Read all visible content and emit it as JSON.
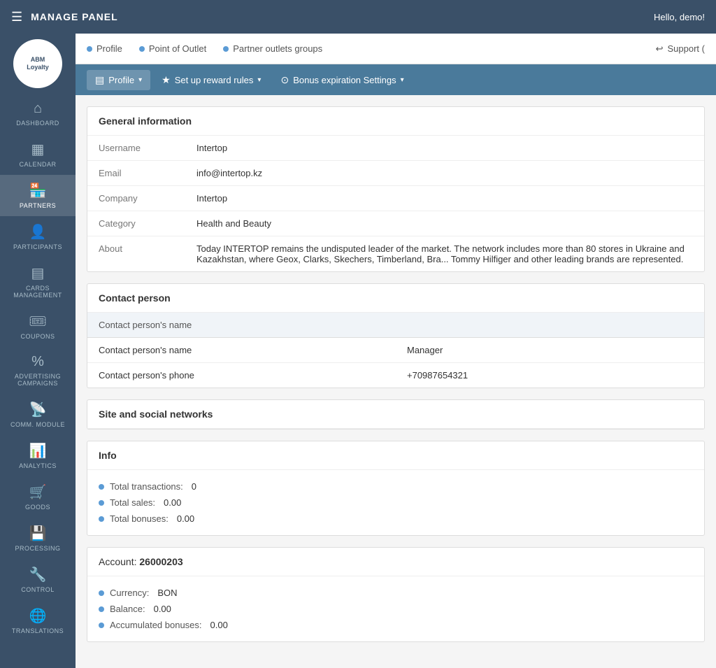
{
  "topbar": {
    "title": "MANAGE PANEL",
    "greeting": "Hello, demo!"
  },
  "logo": {
    "line1": "ABM",
    "line2": "Loyalty"
  },
  "sidebar": {
    "items": [
      {
        "label": "DASHBOARD",
        "icon": "⌂"
      },
      {
        "label": "CALENDAR",
        "icon": "▦"
      },
      {
        "label": "PARTNERS",
        "icon": "🏪",
        "active": true
      },
      {
        "label": "PARTICIPANTS",
        "icon": "👤"
      },
      {
        "label": "CARDS MANAGEMENT",
        "icon": "▤"
      },
      {
        "label": "COUPONS",
        "icon": "▤"
      },
      {
        "label": "ADVERTISING CAMPAIGNS",
        "icon": "%"
      },
      {
        "label": "COMM. MODULE",
        "icon": "📡"
      },
      {
        "label": "ANALYTICS",
        "icon": "📊"
      },
      {
        "label": "GOODS",
        "icon": "🛒"
      },
      {
        "label": "PROCESSING",
        "icon": "💾"
      },
      {
        "label": "CONTROL",
        "icon": "🔧"
      },
      {
        "label": "TRANSLATIONS",
        "icon": "🌐"
      }
    ]
  },
  "subnav": {
    "items": [
      {
        "label": "Profile"
      },
      {
        "label": "Point of Outlet"
      },
      {
        "label": "Partner outlets groups"
      }
    ],
    "support": "Support ("
  },
  "tabbar": {
    "tabs": [
      {
        "label": "Profile",
        "icon": "▤",
        "active": true
      },
      {
        "label": "Set up reward rules",
        "icon": "★"
      },
      {
        "label": "Bonus expiration Settings",
        "icon": "⊙"
      }
    ]
  },
  "general": {
    "section_title": "General information",
    "rows": [
      {
        "label": "Username",
        "value": "Intertop"
      },
      {
        "label": "Email",
        "value": "info@intertop.kz"
      },
      {
        "label": "Company",
        "value": "Intertop"
      },
      {
        "label": "Category",
        "value": "Health and Beauty"
      },
      {
        "label": "About",
        "value": "Today INTERTOP remains the undisputed leader of the market. The network includes more than 80 stores in Ukraine and Kazakhstan, where Geox, Clarks, Skechers, Timberland, Bra... Tommy Hilfiger and other leading brands are represented."
      }
    ]
  },
  "contact": {
    "section_title": "Contact person",
    "headers": [
      "Contact person's name",
      ""
    ],
    "rows": [
      {
        "label": "Contact person's name",
        "value": "Manager"
      },
      {
        "label": "Contact person's phone",
        "value": "+70987654321"
      }
    ]
  },
  "social": {
    "section_title": "Site and social networks"
  },
  "info": {
    "section_title": "Info",
    "items": [
      {
        "label": "Total transactions:",
        "value": "0"
      },
      {
        "label": "Total sales:",
        "value": "0.00"
      },
      {
        "label": "Total bonuses:",
        "value": "0.00"
      }
    ]
  },
  "account": {
    "label": "Account:",
    "number": "26000203",
    "items": [
      {
        "label": "Currency:",
        "value": "BON"
      },
      {
        "label": "Balance:",
        "value": "0.00"
      },
      {
        "label": "Accumulated bonuses:",
        "value": "0.00"
      }
    ]
  }
}
